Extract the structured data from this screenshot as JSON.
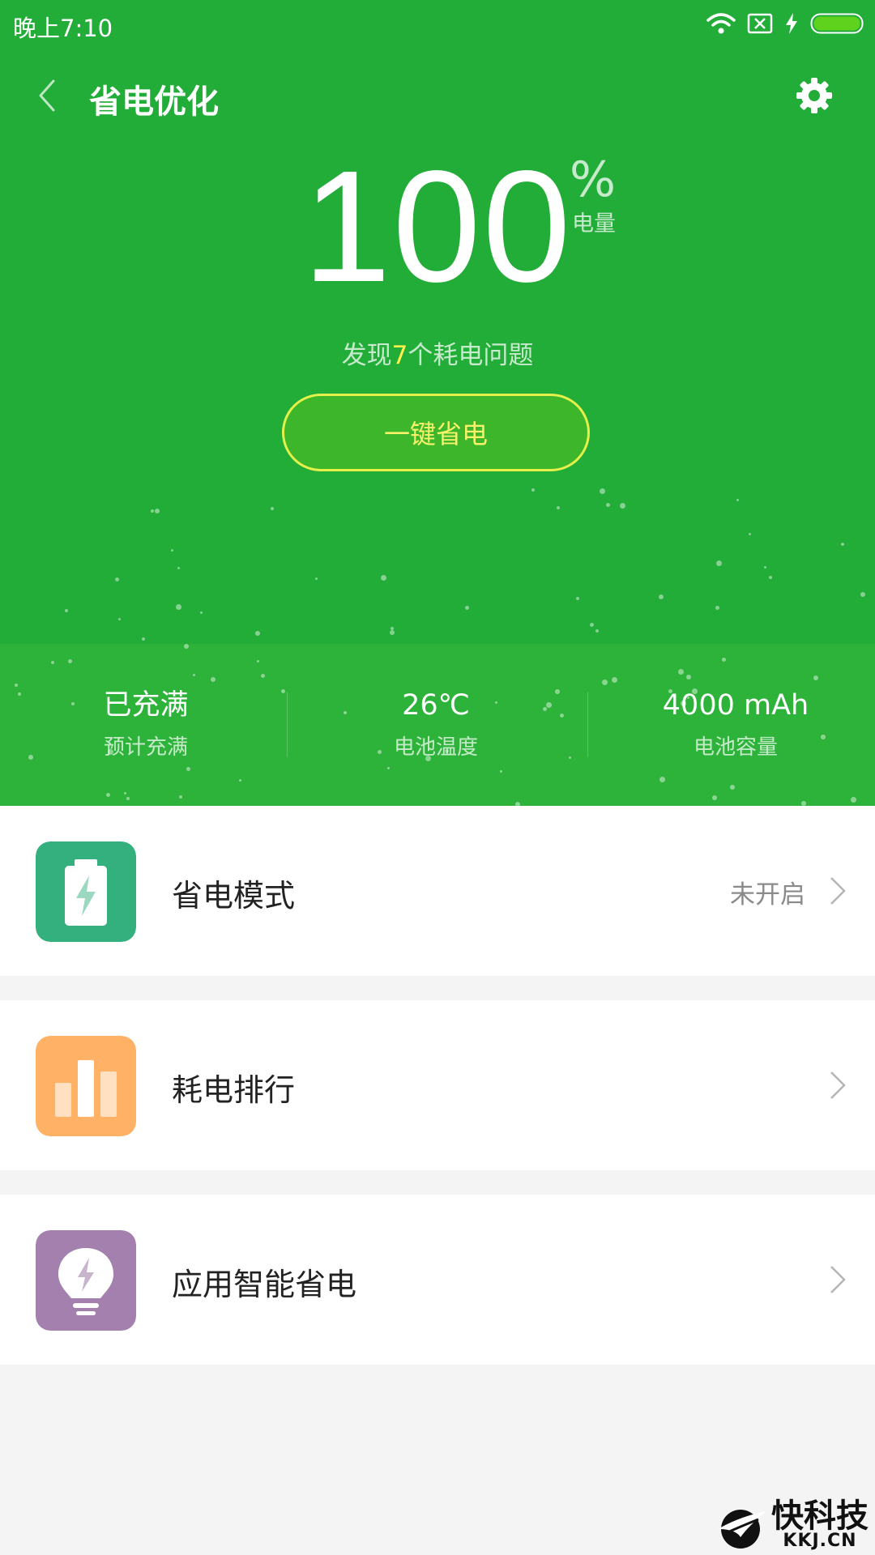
{
  "status_bar": {
    "time": "晚上7:10"
  },
  "header": {
    "title": "省电优化"
  },
  "battery": {
    "value": "100",
    "unit": "%",
    "caption": "电量"
  },
  "issues": {
    "prefix": "发现",
    "count": "7",
    "suffix": "个耗电问题"
  },
  "action_button": {
    "label": "一键省电"
  },
  "stats": [
    {
      "value": "已充满",
      "label": "预计充满"
    },
    {
      "value": "26℃",
      "label": "电池温度"
    },
    {
      "value": "4000 mAh",
      "label": "电池容量"
    }
  ],
  "menu": [
    {
      "label": "省电模式",
      "status": "未开启",
      "icon": "battery-bolt-icon",
      "color": "#34b07f"
    },
    {
      "label": "耗电排行",
      "status": "",
      "icon": "bar-chart-icon",
      "color": "#ffb266"
    },
    {
      "label": "应用智能省电",
      "status": "",
      "icon": "lightbulb-bolt-icon",
      "color": "#a380ad"
    }
  ],
  "watermark": {
    "name": "快科技",
    "domain": "KKJ.CN"
  },
  "colors": {
    "header_green": "#22ac38",
    "highlight_yellow": "#fff14a"
  }
}
